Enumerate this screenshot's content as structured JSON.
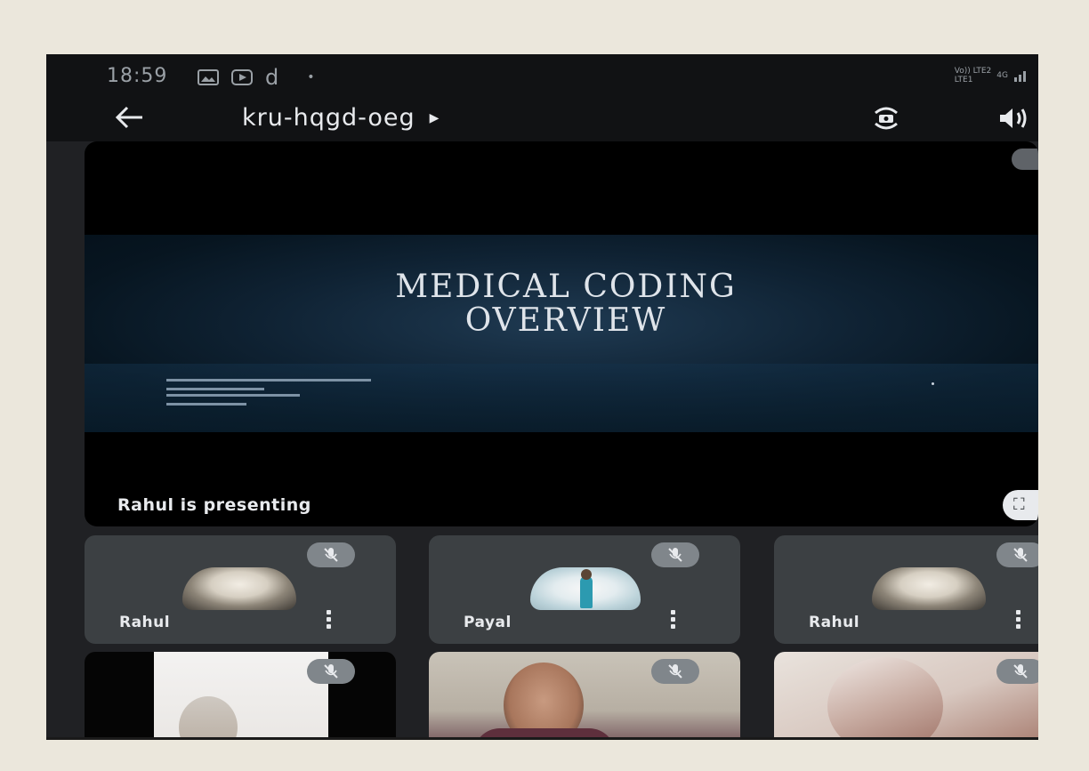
{
  "status_bar": {
    "time": "18:59",
    "icons": [
      "gallery-icon",
      "play-icon",
      "d-icon",
      "dot-icon"
    ],
    "network_top": "Vo)) LTE2",
    "network_bottom": "LTE1 ",
    "signal": "4G"
  },
  "app_bar": {
    "meeting_code": "kru-hqgd-oeg",
    "back_icon": "back-arrow-icon",
    "camera_icon": "switch-camera-icon",
    "audio_icon": "speaker-icon"
  },
  "presentation": {
    "slide_title_line1": "MEDICAL CODING",
    "slide_title_line2": "OVERVIEW",
    "presenting_text": "Rahul is presenting"
  },
  "participants": [
    {
      "name": "Rahul",
      "avatar": "sketch",
      "muted": true
    },
    {
      "name": "Payal",
      "avatar": "photo",
      "muted": true
    },
    {
      "name": "Rahul",
      "avatar": "sketch",
      "muted": true
    }
  ],
  "video_tiles": [
    {
      "name": "",
      "muted": true
    },
    {
      "name": "",
      "muted": true
    },
    {
      "name": "",
      "muted": true
    }
  ]
}
